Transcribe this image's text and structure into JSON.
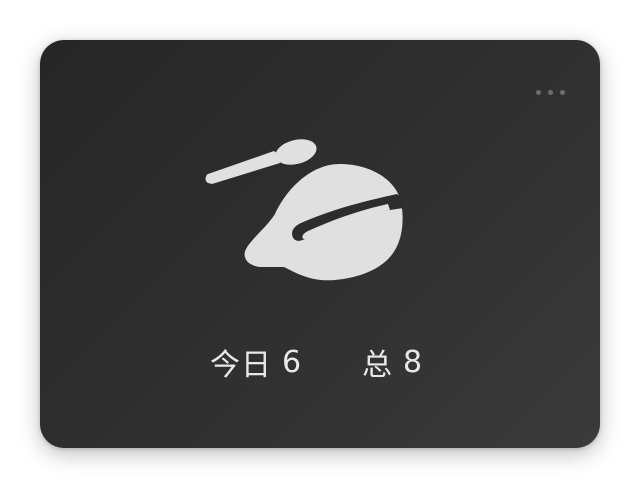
{
  "widget": {
    "more_menu_icon": "ellipsis-icon",
    "illustration_icon": "roast-chicken-with-spoon-icon",
    "stats": {
      "today_label": "今日",
      "today_value": "6",
      "total_label": "总",
      "total_value": "8"
    },
    "colors": {
      "background_dark": "#262626",
      "background_light": "#3a3a3a",
      "icon_fill": "#e0e0e0",
      "text": "#e8e8e8",
      "dots": "#6e6e6e"
    }
  }
}
